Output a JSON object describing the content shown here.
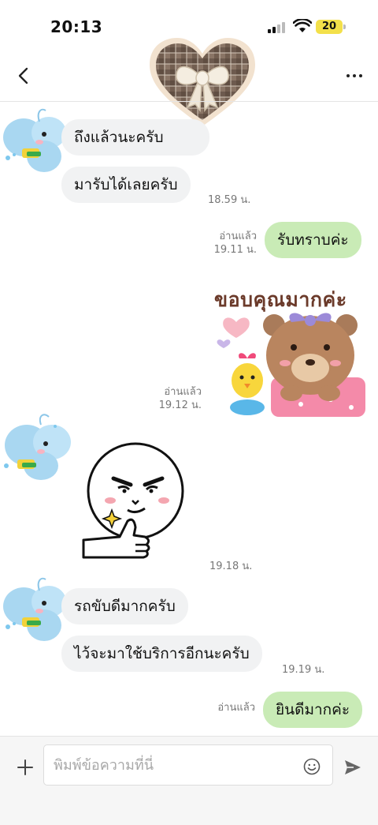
{
  "status_bar": {
    "time": "20:13",
    "battery": "20"
  },
  "messages": [
    {
      "text": "ถึงแล้วนะครับ"
    },
    {
      "text": "มารับได้เลยครับ",
      "time": "18.59 น."
    },
    {
      "text": "รับทราบค่ะ",
      "read": "อ่านแล้ว",
      "time": "19.11 น."
    },
    {
      "sticker_text": "ขอบคุณมากค่ะ",
      "read": "อ่านแล้ว",
      "time": "19.12 น."
    },
    {
      "time": "19.18 น."
    },
    {
      "text": "รถขับดีมากครับ"
    },
    {
      "text": "ไว้จะมาใช้บริการอีกนะครับ",
      "time": "19.19 น."
    },
    {
      "text": "ยินดีมากค่ะ",
      "read": "อ่านแล้ว"
    }
  ],
  "composer": {
    "placeholder": "พิมพ์ข้อความที่นี่"
  },
  "colors": {
    "outgoing_bubble": "#c9ebb6",
    "incoming_bubble": "#f1f2f3",
    "battery": "#f3e04a"
  }
}
